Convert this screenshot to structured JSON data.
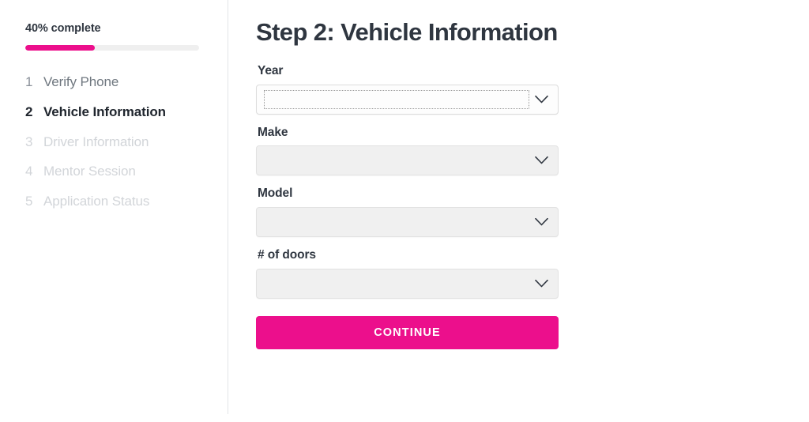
{
  "colors": {
    "accent_pink": "#ec0f8c",
    "progress_track": "#efefef",
    "field_bg": "#f0f0f0",
    "field_border": "#e2e2e2",
    "divider": "#e3e5e8",
    "text_dark": "#2f3640",
    "text_muted": "#707880",
    "text_disabled": "#d2d5d9"
  },
  "sidebar": {
    "progress_label": "40% complete",
    "progress_percent": 40,
    "steps": [
      {
        "number": "1",
        "label": "Verify Phone",
        "state": "done"
      },
      {
        "number": "2",
        "label": "Vehicle Information",
        "state": "active"
      },
      {
        "number": "3",
        "label": "Driver Information",
        "state": "upcoming"
      },
      {
        "number": "4",
        "label": "Mentor Session",
        "state": "upcoming"
      },
      {
        "number": "5",
        "label": "Application Status",
        "state": "upcoming"
      }
    ]
  },
  "main": {
    "title": "Step 2: Vehicle Information",
    "fields": [
      {
        "label": "Year",
        "value": "",
        "focused": true,
        "icon": "chevron-down-icon"
      },
      {
        "label": "Make",
        "value": "",
        "focused": false,
        "icon": "chevron-down-icon"
      },
      {
        "label": "Model",
        "value": "",
        "focused": false,
        "icon": "chevron-down-icon"
      },
      {
        "label": "# of doors",
        "value": "",
        "focused": false,
        "icon": "chevron-down-icon"
      }
    ],
    "submit_label": "CONTINUE"
  }
}
